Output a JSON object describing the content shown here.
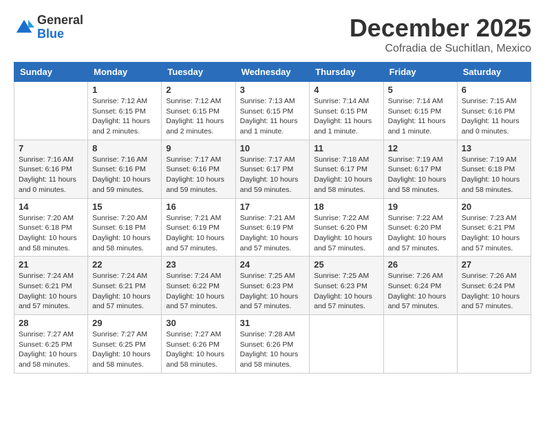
{
  "header": {
    "logo_general": "General",
    "logo_blue": "Blue",
    "month_title": "December 2025",
    "location": "Cofradia de Suchitlan, Mexico"
  },
  "weekdays": [
    "Sunday",
    "Monday",
    "Tuesday",
    "Wednesday",
    "Thursday",
    "Friday",
    "Saturday"
  ],
  "weeks": [
    [
      {
        "day": "",
        "info": ""
      },
      {
        "day": "1",
        "info": "Sunrise: 7:12 AM\nSunset: 6:15 PM\nDaylight: 11 hours\nand 2 minutes."
      },
      {
        "day": "2",
        "info": "Sunrise: 7:12 AM\nSunset: 6:15 PM\nDaylight: 11 hours\nand 2 minutes."
      },
      {
        "day": "3",
        "info": "Sunrise: 7:13 AM\nSunset: 6:15 PM\nDaylight: 11 hours\nand 1 minute."
      },
      {
        "day": "4",
        "info": "Sunrise: 7:14 AM\nSunset: 6:15 PM\nDaylight: 11 hours\nand 1 minute."
      },
      {
        "day": "5",
        "info": "Sunrise: 7:14 AM\nSunset: 6:15 PM\nDaylight: 11 hours\nand 1 minute."
      },
      {
        "day": "6",
        "info": "Sunrise: 7:15 AM\nSunset: 6:16 PM\nDaylight: 11 hours\nand 0 minutes."
      }
    ],
    [
      {
        "day": "7",
        "info": "Sunrise: 7:16 AM\nSunset: 6:16 PM\nDaylight: 11 hours\nand 0 minutes."
      },
      {
        "day": "8",
        "info": "Sunrise: 7:16 AM\nSunset: 6:16 PM\nDaylight: 10 hours\nand 59 minutes."
      },
      {
        "day": "9",
        "info": "Sunrise: 7:17 AM\nSunset: 6:16 PM\nDaylight: 10 hours\nand 59 minutes."
      },
      {
        "day": "10",
        "info": "Sunrise: 7:17 AM\nSunset: 6:17 PM\nDaylight: 10 hours\nand 59 minutes."
      },
      {
        "day": "11",
        "info": "Sunrise: 7:18 AM\nSunset: 6:17 PM\nDaylight: 10 hours\nand 58 minutes."
      },
      {
        "day": "12",
        "info": "Sunrise: 7:19 AM\nSunset: 6:17 PM\nDaylight: 10 hours\nand 58 minutes."
      },
      {
        "day": "13",
        "info": "Sunrise: 7:19 AM\nSunset: 6:18 PM\nDaylight: 10 hours\nand 58 minutes."
      }
    ],
    [
      {
        "day": "14",
        "info": "Sunrise: 7:20 AM\nSunset: 6:18 PM\nDaylight: 10 hours\nand 58 minutes."
      },
      {
        "day": "15",
        "info": "Sunrise: 7:20 AM\nSunset: 6:18 PM\nDaylight: 10 hours\nand 58 minutes."
      },
      {
        "day": "16",
        "info": "Sunrise: 7:21 AM\nSunset: 6:19 PM\nDaylight: 10 hours\nand 57 minutes."
      },
      {
        "day": "17",
        "info": "Sunrise: 7:21 AM\nSunset: 6:19 PM\nDaylight: 10 hours\nand 57 minutes."
      },
      {
        "day": "18",
        "info": "Sunrise: 7:22 AM\nSunset: 6:20 PM\nDaylight: 10 hours\nand 57 minutes."
      },
      {
        "day": "19",
        "info": "Sunrise: 7:22 AM\nSunset: 6:20 PM\nDaylight: 10 hours\nand 57 minutes."
      },
      {
        "day": "20",
        "info": "Sunrise: 7:23 AM\nSunset: 6:21 PM\nDaylight: 10 hours\nand 57 minutes."
      }
    ],
    [
      {
        "day": "21",
        "info": "Sunrise: 7:24 AM\nSunset: 6:21 PM\nDaylight: 10 hours\nand 57 minutes."
      },
      {
        "day": "22",
        "info": "Sunrise: 7:24 AM\nSunset: 6:21 PM\nDaylight: 10 hours\nand 57 minutes."
      },
      {
        "day": "23",
        "info": "Sunrise: 7:24 AM\nSunset: 6:22 PM\nDaylight: 10 hours\nand 57 minutes."
      },
      {
        "day": "24",
        "info": "Sunrise: 7:25 AM\nSunset: 6:23 PM\nDaylight: 10 hours\nand 57 minutes."
      },
      {
        "day": "25",
        "info": "Sunrise: 7:25 AM\nSunset: 6:23 PM\nDaylight: 10 hours\nand 57 minutes."
      },
      {
        "day": "26",
        "info": "Sunrise: 7:26 AM\nSunset: 6:24 PM\nDaylight: 10 hours\nand 57 minutes."
      },
      {
        "day": "27",
        "info": "Sunrise: 7:26 AM\nSunset: 6:24 PM\nDaylight: 10 hours\nand 57 minutes."
      }
    ],
    [
      {
        "day": "28",
        "info": "Sunrise: 7:27 AM\nSunset: 6:25 PM\nDaylight: 10 hours\nand 58 minutes."
      },
      {
        "day": "29",
        "info": "Sunrise: 7:27 AM\nSunset: 6:25 PM\nDaylight: 10 hours\nand 58 minutes."
      },
      {
        "day": "30",
        "info": "Sunrise: 7:27 AM\nSunset: 6:26 PM\nDaylight: 10 hours\nand 58 minutes."
      },
      {
        "day": "31",
        "info": "Sunrise: 7:28 AM\nSunset: 6:26 PM\nDaylight: 10 hours\nand 58 minutes."
      },
      {
        "day": "",
        "info": ""
      },
      {
        "day": "",
        "info": ""
      },
      {
        "day": "",
        "info": ""
      }
    ]
  ]
}
